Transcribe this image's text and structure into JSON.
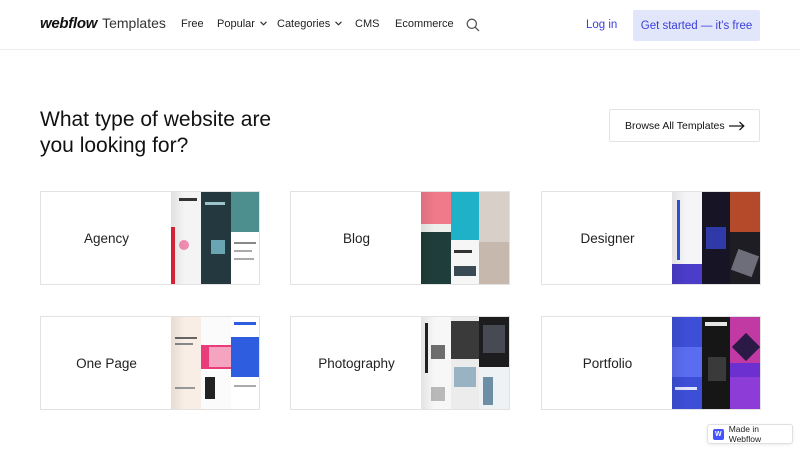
{
  "nav": {
    "brand": "webflow",
    "brand_suffix": "Templates",
    "links": [
      "Free",
      "Popular",
      "Categories",
      "CMS",
      "Ecommerce"
    ],
    "login": "Log in",
    "cta": "Get started — it's free"
  },
  "hero": {
    "headline_line1": "What type of website are",
    "headline_line2": "you looking for?",
    "browse_label": "Browse All Templates"
  },
  "categories": [
    "Agency",
    "Blog",
    "Designer",
    "One Page",
    "Photography",
    "Portfolio"
  ],
  "badge": {
    "label": "Made in Webflow",
    "icon_letter": "W"
  },
  "colors": {
    "accent": "#3b3fd8",
    "cta_bg": "#e2e6fb",
    "badge_icon": "#4353ff"
  },
  "icons": [
    "search-icon",
    "chevron-down-icon",
    "arrow-right-icon",
    "webflow-logo-icon"
  ]
}
